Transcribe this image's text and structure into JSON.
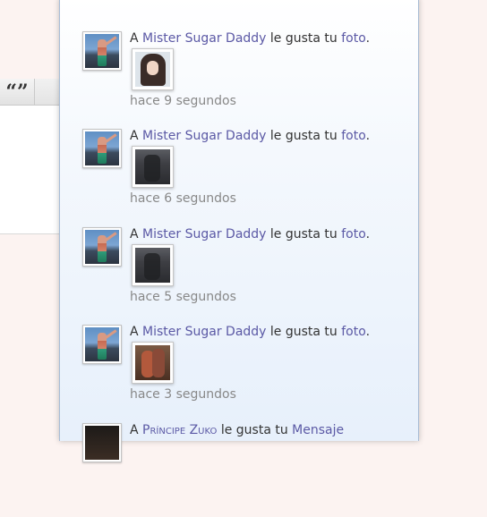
{
  "toolbar": {
    "quote_glyph": "“”"
  },
  "notifications": [
    {
      "prefix": "A",
      "user": "Mister Sugar Daddy",
      "verb": "le gusta tu",
      "object": "foto",
      "end": ".",
      "time": "hace 9 segundos"
    },
    {
      "prefix": "A",
      "user": "Mister Sugar Daddy",
      "verb": "le gusta tu",
      "object": "foto",
      "end": ".",
      "time": "hace 6 segundos"
    },
    {
      "prefix": "A",
      "user": "Mister Sugar Daddy",
      "verb": "le gusta tu",
      "object": "foto",
      "end": ".",
      "time": "hace 5 segundos"
    },
    {
      "prefix": "A",
      "user": "Mister Sugar Daddy",
      "verb": "le gusta tu",
      "object": "foto",
      "end": ".",
      "time": "hace 3 segundos"
    },
    {
      "prefix": "A",
      "user": "Príncipe Zuko",
      "verb": "le gusta tu",
      "object": "Mensaje"
    }
  ]
}
